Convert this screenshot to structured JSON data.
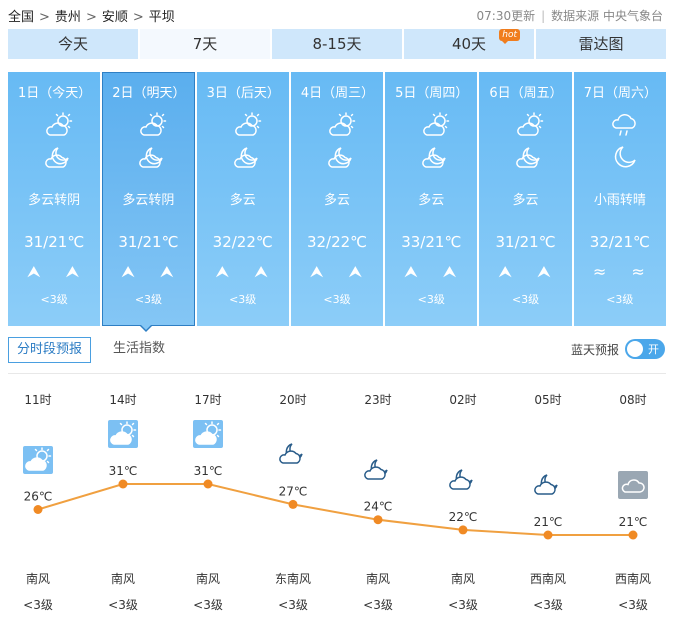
{
  "breadcrumb": [
    "全国",
    "贵州",
    "安顺",
    "平坝"
  ],
  "breadcrumb_sep": ">",
  "meta": {
    "updated": "07:30更新",
    "source": "数据来源 中央气象台"
  },
  "tabs": [
    {
      "label": "今天",
      "active": false
    },
    {
      "label": "7天",
      "active": true
    },
    {
      "label": "8-15天",
      "active": false
    },
    {
      "label": "40天",
      "active": false,
      "badge": "hot"
    },
    {
      "label": "雷达图",
      "active": false
    }
  ],
  "days": [
    {
      "date": "1日（今天）",
      "icon_day": "cloudy-day-icon",
      "icon_night": "cloudy-night-icon",
      "weather": "多云转阴",
      "temp": "31/21℃",
      "wind_symbols": "⮝ ⮝",
      "wind_level": "<3级",
      "active": false
    },
    {
      "date": "2日（明天）",
      "icon_day": "cloudy-day-icon",
      "icon_night": "cloudy-night-icon",
      "weather": "多云转阴",
      "temp": "31/21℃",
      "wind_symbols": "⮝ ⮝",
      "wind_level": "<3级",
      "active": true
    },
    {
      "date": "3日（后天）",
      "icon_day": "cloudy-day-icon",
      "icon_night": "cloudy-night-icon",
      "weather": "多云",
      "temp": "32/22℃",
      "wind_symbols": "⮝ ⮝",
      "wind_level": "<3级",
      "active": false
    },
    {
      "date": "4日（周三）",
      "icon_day": "cloudy-day-icon",
      "icon_night": "cloudy-night-icon",
      "weather": "多云",
      "temp": "32/22℃",
      "wind_symbols": "⮝ ⮝",
      "wind_level": "<3级",
      "active": false
    },
    {
      "date": "5日（周四）",
      "icon_day": "cloudy-day-icon",
      "icon_night": "cloudy-night-icon",
      "weather": "多云",
      "temp": "33/21℃",
      "wind_symbols": "⮝ ⮝",
      "wind_level": "<3级",
      "active": false
    },
    {
      "date": "6日（周五）",
      "icon_day": "cloudy-day-icon",
      "icon_night": "cloudy-night-icon",
      "weather": "多云",
      "temp": "31/21℃",
      "wind_symbols": "⮝ ⮝",
      "wind_level": "<3级",
      "active": false
    },
    {
      "date": "7日（周六）",
      "icon_day": "rain-icon",
      "icon_night": "moon-icon",
      "weather": "小雨转晴",
      "temp": "32/21℃",
      "wind_symbols": "≈ ≈",
      "wind_level": "<3级",
      "active": false
    }
  ],
  "subtabs": [
    {
      "label": "分时段预报",
      "active": true
    },
    {
      "label": "生活指数",
      "active": false
    }
  ],
  "toggle": {
    "label": "蓝天预报",
    "state": "开"
  },
  "hourly": [
    {
      "time": "11时",
      "temp": 26,
      "temp_label": "26℃",
      "icon": "cloudy-day-icon",
      "wind_dir": "南风",
      "wind_level": "<3级"
    },
    {
      "time": "14时",
      "temp": 31,
      "temp_label": "31℃",
      "icon": "cloudy-day-icon",
      "wind_dir": "南风",
      "wind_level": "<3级"
    },
    {
      "time": "17时",
      "temp": 31,
      "temp_label": "31℃",
      "icon": "cloudy-day-icon",
      "wind_dir": "南风",
      "wind_level": "<3级"
    },
    {
      "time": "20时",
      "temp": 27,
      "temp_label": "27℃",
      "icon": "cloudy-night-icon",
      "wind_dir": "东南风",
      "wind_level": "<3级"
    },
    {
      "time": "23时",
      "temp": 24,
      "temp_label": "24℃",
      "icon": "cloudy-night-icon",
      "wind_dir": "南风",
      "wind_level": "<3级"
    },
    {
      "time": "02时",
      "temp": 22,
      "temp_label": "22℃",
      "icon": "cloudy-night-icon",
      "wind_dir": "南风",
      "wind_level": "<3级"
    },
    {
      "time": "05时",
      "temp": 21,
      "temp_label": "21℃",
      "icon": "cloudy-night-icon",
      "wind_dir": "西南风",
      "wind_level": "<3级"
    },
    {
      "time": "08时",
      "temp": 21,
      "temp_label": "21℃",
      "icon": "overcast-icon",
      "wind_dir": "西南风",
      "wind_level": "<3级"
    }
  ],
  "colors": {
    "accent": "#4ba7ea",
    "line": "#f0a040",
    "point": "#f08a24",
    "card": "#67baf4"
  }
}
